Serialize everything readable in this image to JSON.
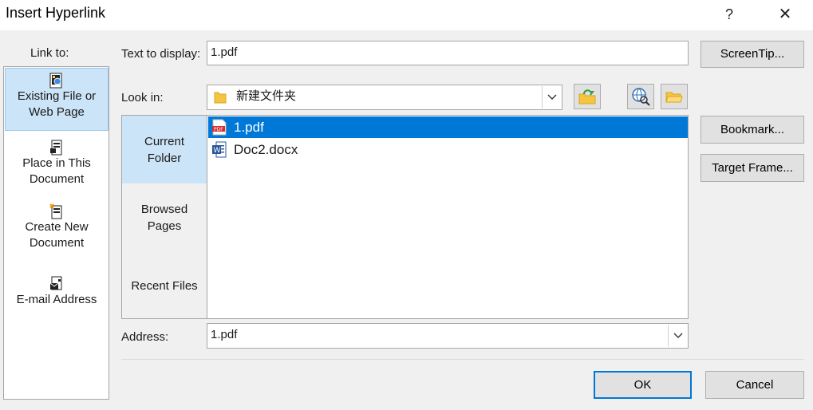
{
  "window": {
    "title": "Insert Hyperlink",
    "help": "?",
    "close": "✕"
  },
  "link_to": {
    "label": "Link to:",
    "items": [
      {
        "line1": "Existing File or",
        "line2": "Web Page",
        "icon": "web-page-icon",
        "selected": true
      },
      {
        "line1": "Place in This",
        "line2": "Document",
        "icon": "document-place-icon",
        "selected": false
      },
      {
        "line1": "Create New",
        "line2": "Document",
        "icon": "new-document-icon",
        "selected": false
      },
      {
        "line1": "E-mail Address",
        "line2": "",
        "icon": "email-icon",
        "selected": false
      }
    ]
  },
  "text_to_display": {
    "label": "Text to display:",
    "value": "1.pdf"
  },
  "screentip": {
    "label": "ScreenTip..."
  },
  "look_in": {
    "label": "Look in:",
    "value": "新建文件夹",
    "icon": "folder-icon"
  },
  "toolbar_icons": [
    "up-one-folder-icon",
    "browse-web-icon",
    "browse-file-icon"
  ],
  "nav": [
    {
      "line1": "Current",
      "line2": "Folder",
      "selected": true
    },
    {
      "line1": "Browsed",
      "line2": "Pages",
      "selected": false
    },
    {
      "line1": "Recent Files",
      "line2": "",
      "selected": false
    }
  ],
  "files": [
    {
      "name": "1.pdf",
      "icon": "pdf-icon",
      "selected": true
    },
    {
      "name": "Doc2.docx",
      "icon": "word-doc-icon",
      "selected": false
    }
  ],
  "side_buttons": {
    "bookmark": "Bookmark...",
    "target_frame": "Target Frame..."
  },
  "address": {
    "label": "Address:",
    "value": "1.pdf"
  },
  "ok": "OK",
  "cancel": "Cancel",
  "colors": {
    "selection": "#0078d7",
    "highlight": "#cce4f7"
  }
}
